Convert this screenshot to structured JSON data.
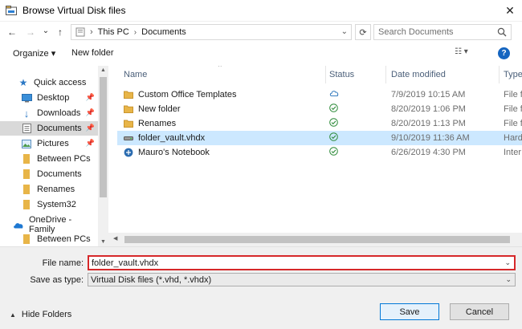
{
  "window": {
    "title": "Browse Virtual Disk files",
    "close_glyph": "✕"
  },
  "nav": {
    "back_glyph": "←",
    "forward_glyph": "→",
    "recent_glyph": "⌄",
    "up_glyph": "↑",
    "breadcrumbs": [
      "This PC",
      "Documents"
    ],
    "separator": "›",
    "search_placeholder": "Search Documents",
    "refresh_glyph": "⟳"
  },
  "toolbar": {
    "organize_label": "Organize ▾",
    "new_folder_label": "New folder",
    "view_glyph": "☷ ▾",
    "help_glyph": "?"
  },
  "sidebar": {
    "items": [
      {
        "label": "Quick access",
        "icon": "star-icon",
        "pinned": false
      },
      {
        "label": "Desktop",
        "icon": "desktop-icon",
        "pinned": true
      },
      {
        "label": "Downloads",
        "icon": "download-icon",
        "pinned": true
      },
      {
        "label": "Documents",
        "icon": "documents-icon",
        "pinned": true,
        "selected": true
      },
      {
        "label": "Pictures",
        "icon": "pictures-icon",
        "pinned": true
      },
      {
        "label": "Between PCs",
        "icon": "folder-icon",
        "pinned": false
      },
      {
        "label": "Documents",
        "icon": "folder-icon",
        "pinned": false
      },
      {
        "label": "Renames",
        "icon": "folder-icon",
        "pinned": false
      },
      {
        "label": "System32",
        "icon": "folder-icon",
        "pinned": false
      },
      {
        "label": "OneDrive - Family",
        "icon": "cloud-icon",
        "pinned": false
      },
      {
        "label": "Between PCs",
        "icon": "folder-icon",
        "pinned": false
      }
    ]
  },
  "files": {
    "columns": {
      "name": "Name",
      "status": "Status",
      "date": "Date modified",
      "type": "Type"
    },
    "rows": [
      {
        "name": "Custom Office Templates",
        "icon": "folder-icon",
        "status": "cloud",
        "date": "7/9/2019 10:15 AM",
        "type": "File f"
      },
      {
        "name": "New folder",
        "icon": "folder-icon",
        "status": "synced",
        "date": "8/20/2019 1:06 PM",
        "type": "File f"
      },
      {
        "name": "Renames",
        "icon": "folder-icon",
        "status": "synced",
        "date": "8/20/2019 1:13 PM",
        "type": "File f"
      },
      {
        "name": "folder_vault.vhdx",
        "icon": "disk-icon",
        "status": "synced",
        "date": "9/10/2019 11:36 AM",
        "type": "Hard",
        "selected": true
      },
      {
        "name": "Mauro's Notebook",
        "icon": "onenote-icon",
        "status": "synced",
        "date": "6/26/2019 4:30 PM",
        "type": "Inter"
      }
    ]
  },
  "bottom": {
    "file_name_label": "File name:",
    "file_name_value": "folder_vault.vhdx",
    "save_type_label": "Save as type:",
    "save_type_value": "Virtual Disk files (*.vhd, *.vhdx)",
    "hide_folders_label": "Hide Folders",
    "save_label": "Save",
    "cancel_label": "Cancel"
  },
  "colors": {
    "accent": "#0078d7",
    "folder": "#e8b548",
    "selection": "#cce8ff",
    "highlight_border": "#d6282a",
    "status_green": "#2e8b3a"
  }
}
